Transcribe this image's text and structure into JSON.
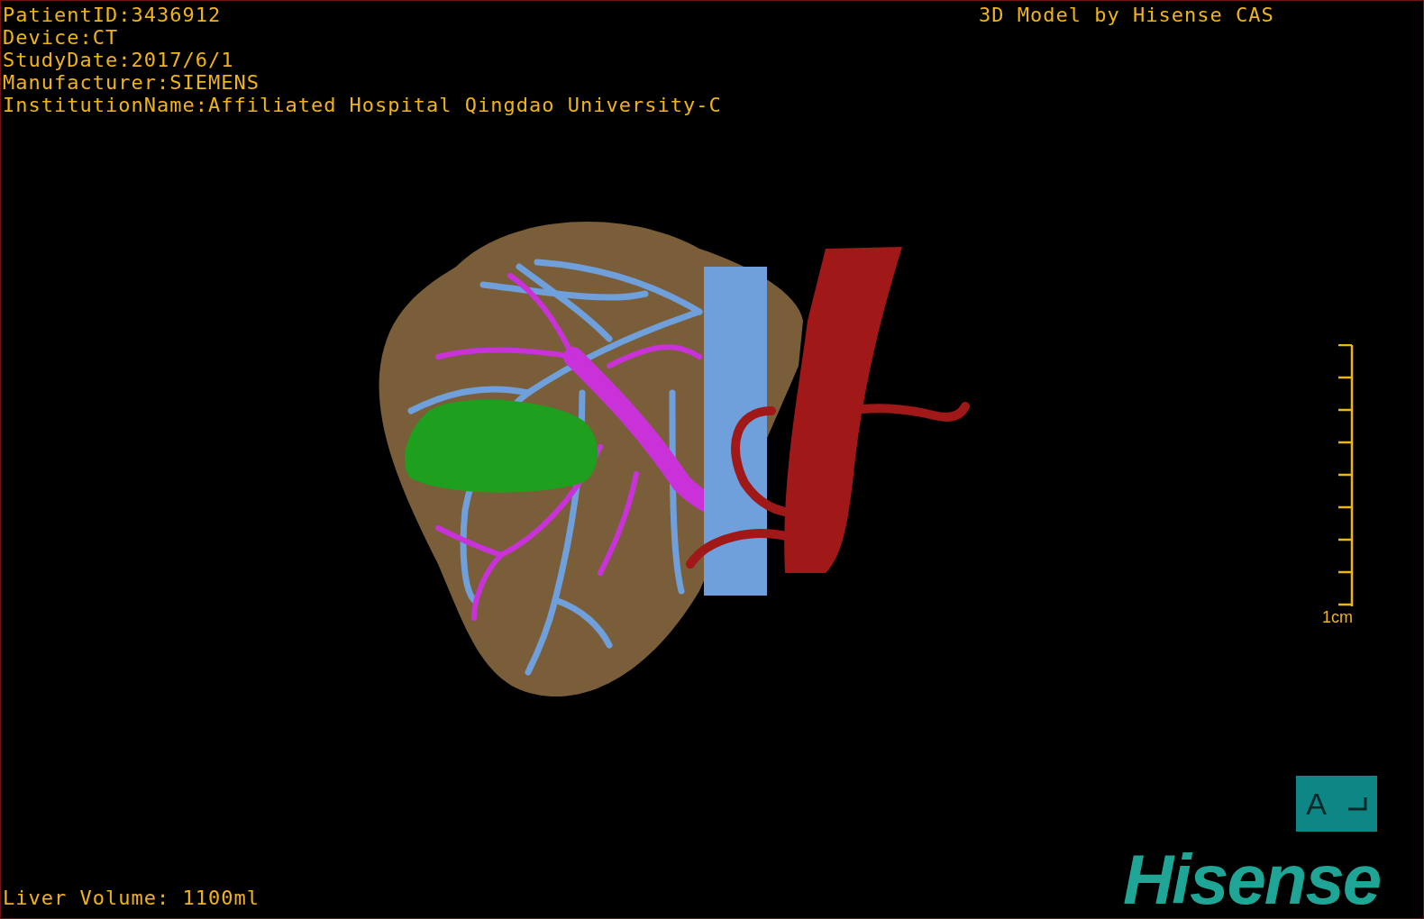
{
  "patient_info": [
    "PatientID:3436912",
    "Device:CT",
    "StudyDate:2017/6/1",
    "Manufacturer:SIEMENS",
    "InstitutionName:Affiliated Hospital Qingdao University-C"
  ],
  "model_credit": "3D Model by Hisense CAS",
  "scale_bar": {
    "label": "1cm"
  },
  "orientation_marker": {
    "label": "A"
  },
  "measurement": "Liver Volume: 1100ml",
  "logo": "Hisense"
}
